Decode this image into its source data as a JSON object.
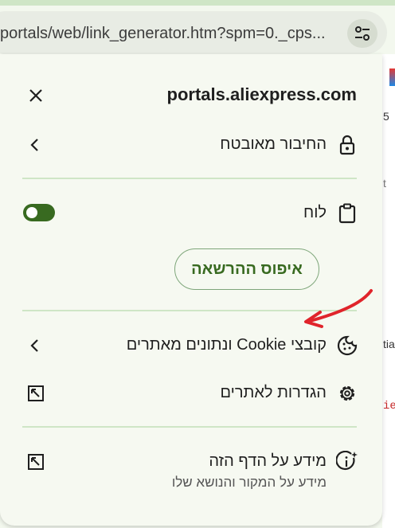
{
  "browser": {
    "url": "portals/web/link_generator.htm?spm=0._cps...",
    "side_text": [
      "5",
      "t",
      "tia",
      "ie"
    ]
  },
  "panel": {
    "site": "portals.aliexpress.com",
    "connection_label": "החיבור מאובטח",
    "clipboard_label": "לוח",
    "reset_button": "איפוס ההרשאה",
    "cookies_label": "קובצי Cookie ונתונים מאתרים",
    "site_settings_label": "הגדרות לאתרים",
    "page_info_title": "מידע על הדף הזה",
    "page_info_sub": "מידע על המקור והנושא שלו"
  },
  "colors": {
    "accent": "#386a20",
    "divider": "#cfe6c6",
    "annotation": "#e0242b"
  }
}
